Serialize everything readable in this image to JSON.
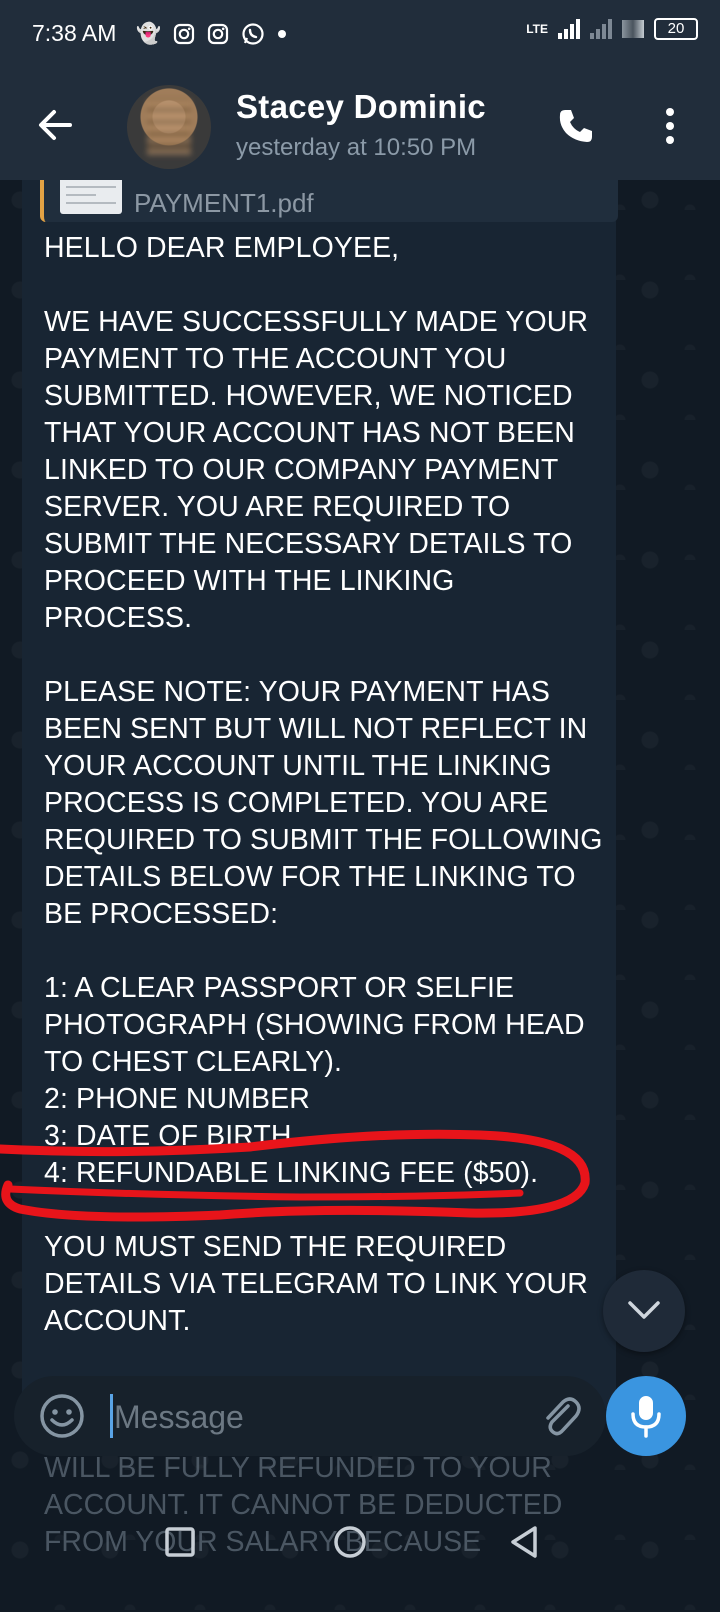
{
  "status_bar": {
    "time": "7:38 AM",
    "network": "LTE",
    "battery": "20",
    "notification_icons": [
      "snapchat-icon",
      "instagram-icon",
      "instagram-icon",
      "whatsapp-icon",
      "dot-icon"
    ]
  },
  "header": {
    "contact_name": "Stacey Dominic",
    "last_seen": "yesterday at 10:50 PM"
  },
  "message": {
    "reply_file": "PAYMENT1.pdf",
    "text": "HELLO DEAR EMPLOYEE,\n\nWE HAVE SUCCESSFULLY MADE YOUR PAYMENT TO THE ACCOUNT YOU SUBMITTED. HOWEVER, WE NOTICED THAT YOUR ACCOUNT HAS NOT BEEN LINKED TO OUR COMPANY PAYMENT SERVER. YOU ARE REQUIRED TO SUBMIT THE NECESSARY DETAILS TO PROCEED WITH THE LINKING PROCESS.\n\nPLEASE NOTE: YOUR PAYMENT HAS BEEN SENT BUT WILL NOT REFLECT IN YOUR ACCOUNT UNTIL THE LINKING PROCESS IS COMPLETED. YOU ARE REQUIRED TO SUBMIT THE FOLLOWING DETAILS BELOW FOR THE LINKING TO BE PROCESSED:\n\n1: A CLEAR PASSPORT OR SELFIE PHOTOGRAPH (SHOWING FROM HEAD TO CHEST CLEARLY).\n2: PHONE NUMBER\n3: DATE OF BIRTH\n4: REFUNDABLE LINKING FEE ($50).\n\nYOU MUST SEND THE REQUIRED DETAILS VIA TELEGRAM TO LINK YOUR ACCOUNT.",
    "overflow_text": "WILL BE FULLY REFUNDED TO YOUR ACCOUNT. IT CANNOT BE DEDUCTED FROM YOUR SALARY BECAUSE"
  },
  "composer": {
    "placeholder": "Message"
  },
  "colors": {
    "header_bg": "#212d3b",
    "bubble_bg": "#182533",
    "accent": "#3a95e0",
    "reply_bar": "#e2a244",
    "annotation": "#e8141a"
  }
}
